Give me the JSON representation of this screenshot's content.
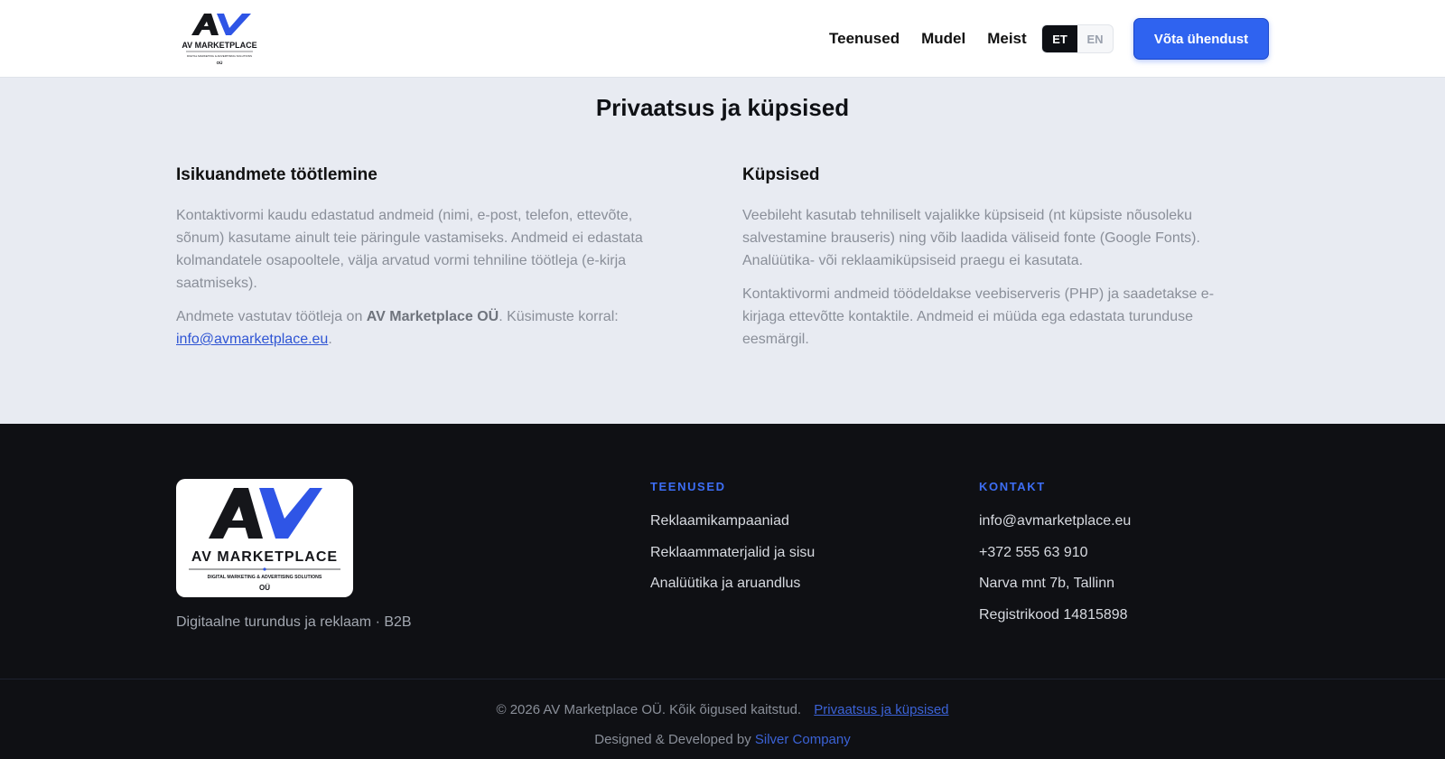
{
  "header": {
    "logo_text": "AV MARKETPLACE",
    "logo_sub": "DIGITAL MARKETING & ADVERTISING SOLUTIONS",
    "logo_suffix": "OÜ",
    "nav": [
      "Teenused",
      "Mudel",
      "Meist"
    ],
    "lang_active": "ET",
    "lang_inactive": "EN",
    "cta_label": "Võta ühendust"
  },
  "main": {
    "title": "Privaatsus ja küpsised",
    "left": {
      "heading": "Isikuandmete töötlemine",
      "p1": "Kontaktivormi kaudu edastatud andmeid (nimi, e-post, telefon, ettevõte, sõnum) kasutame ainult teie päringule vastamiseks. Andmeid ei edastata kolmandatele osapooltele, välja arvatud vormi tehniline töötleja (e-kirja saatmiseks).",
      "p2_prefix": "Andmete vastutav töötleja on ",
      "p2_company": "AV Marketplace OÜ",
      "p2_mid": ". Küsimuste korral: ",
      "p2_email": "info@avmarketplace.eu",
      "p2_end": "."
    },
    "right": {
      "heading": "Küpsised",
      "p1": "Veebileht kasutab tehniliselt vajalikke küpsiseid (nt küpsiste nõusoleku salvestamine brauseris) ning võib laadida väliseid fonte (Google Fonts). Analüütika- või reklaamiküpsiseid praegu ei kasutata.",
      "p2": "Kontaktivormi andmeid töödeldakse veebiserveris (PHP) ja saadetakse e-kirjaga ettevõtte kontaktile. Andmeid ei müüda ega edastata turunduse eesmärgil."
    }
  },
  "footer": {
    "logo_text": "AV MARKETPLACE",
    "logo_sub": "DIGITAL MARKETING & ADVERTISING SOLUTIONS",
    "logo_suffix": "OÜ",
    "tagline": "Digitaalne turundus ja reklaam · B2B",
    "services_heading": "TEENUSED",
    "services": [
      "Reklaamikampaaniad",
      "Reklaammaterjalid ja sisu",
      "Analüütika ja aruandlus"
    ],
    "contact_heading": "KONTAKT",
    "contact": [
      "info@avmarketplace.eu",
      "+372 555 63 910",
      "Narva mnt 7b, Tallinn",
      "Registrikood 14815898"
    ],
    "copyright": "© 2026 AV Marketplace OÜ. Kõik õigused kaitstud.",
    "privacy_link": "Privaatsus ja küpsised",
    "credit_prefix": "Designed & Developed by ",
    "credit_link": "Silver Company"
  },
  "colors": {
    "accent": "#2f63f0",
    "footer_bg": "#0f1014",
    "page_bg": "#e8ebf2",
    "link": "#3b62d6"
  }
}
